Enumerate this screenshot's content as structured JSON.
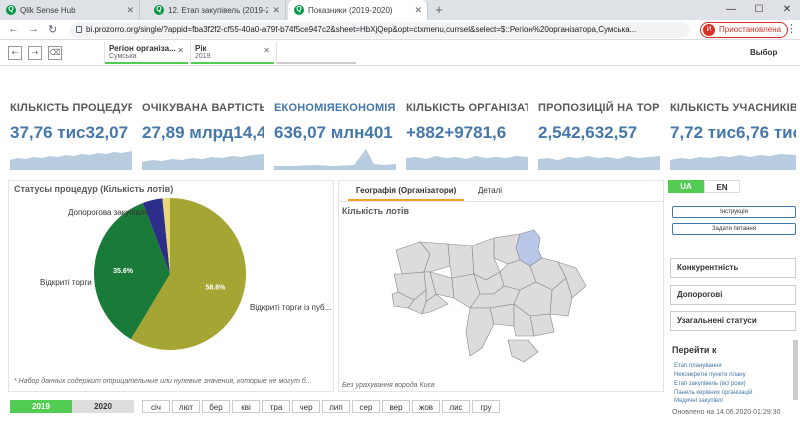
{
  "browser": {
    "tabs": [
      {
        "label": "Qlik Sense Hub"
      },
      {
        "label": "12. Етап закупівель (2019-2020)"
      },
      {
        "label": "Показники (2019-2020)"
      }
    ],
    "url": "bi.prozorro.org/single/?appid=fba3f2f2-cf55-40a0-a79f-b74f5ce947c2&sheet=HbXjQep&opt=ctxmenu,currsel&select=$::Регіон%20організатора,Сумська...",
    "profile": {
      "initial": "И",
      "label": "Приостановлена"
    }
  },
  "selections": {
    "chips": [
      {
        "title": "Регіон організа...",
        "value": "Сумська"
      },
      {
        "title": "Рік",
        "value": "2019"
      }
    ],
    "label": "Выбор"
  },
  "kpis": [
    {
      "title": "КІЛЬКІСТЬ ПРОЦЕДУРКІ...",
      "value": "37,76 тис32,07"
    },
    {
      "title": "ОЧІКУВАНА ВАРТІСТЬОЧ...",
      "value": "27,89 млрд14,4"
    },
    {
      "title": "ЕКОНОМІЯЕКОНОМІЯЕК...",
      "value": "636,07 млн401"
    },
    {
      "title": "КІЛЬКІСТЬ ОРГАНІЗАТОР...",
      "value": "+882+9781,6"
    },
    {
      "title": "ПРОПОЗИЦІЙ НА ТОРГИП...",
      "value": "2,542,632,57"
    },
    {
      "title": "КІЛЬКІСТЬ УЧАСНИКІВКІ...",
      "value": "7,72 тис6,76 тис"
    }
  ],
  "pie_panel": {
    "title": "Статусы процедур (Кількість лотів)",
    "footnote": "* Набор данных содержит отрицательные или нулевые значения, которые не могут б..."
  },
  "chart_data": {
    "type": "pie",
    "slices": [
      {
        "label": "Відкриті торги із пуб...",
        "value": 58.6,
        "pct_label": "58.6%",
        "color": "#a5a533"
      },
      {
        "label": "Відкриті торги",
        "value": 35.6,
        "pct_label": "35.6%",
        "color": "#1a7a3a"
      },
      {
        "label": "Допорогова закупівля",
        "value": 4.2,
        "pct_label": "",
        "color": "#2d2d8a"
      },
      {
        "label": "",
        "value": 1.6,
        "pct_label": "",
        "color": "#e8d87a"
      }
    ]
  },
  "map_panel": {
    "tabs": [
      {
        "label": "Географія (Організатори)"
      },
      {
        "label": "Деталі"
      }
    ],
    "subtitle": "Кількість лотів",
    "note": "Без урахування ворода Києв"
  },
  "right": {
    "lang": [
      "UA",
      "EN"
    ],
    "buttons": [
      "Інструкція",
      "Задати питання"
    ],
    "sections": [
      "Конкурентність",
      "Допорогові",
      "Узагальнені статуси"
    ],
    "goto_title": "Перейти к",
    "links": [
      "Етап планування",
      "Неконкретні пункти плану",
      "Етап закупівель (всі роки)",
      "Панель керівних організацій",
      "Медичні закупівлі"
    ],
    "updated": "Оновлено на 14.06.2020 01:29:30"
  },
  "footer": {
    "years": [
      "2019",
      "2020"
    ],
    "months": [
      "січ",
      "лют",
      "бер",
      "кві",
      "тра",
      "чер",
      "лип",
      "сер",
      "вер",
      "жов",
      "лис",
      "гру"
    ]
  },
  "colors": {
    "accent": "#52cc52",
    "kpi_blue": "#4477aa",
    "sparkline": "#b8cce0"
  }
}
